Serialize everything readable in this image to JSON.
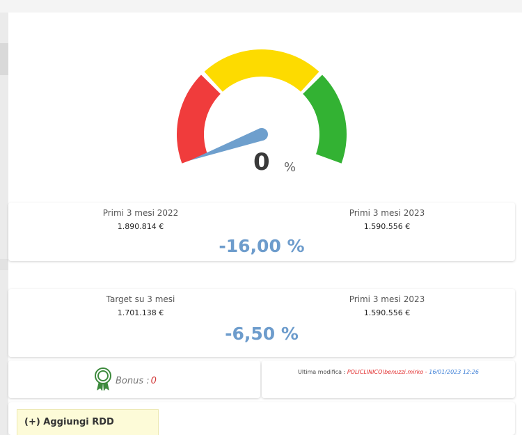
{
  "gauge": {
    "value": "0",
    "unit": "%",
    "level": 0,
    "colors": {
      "red": "#f03c3c",
      "yellow": "#fddb00",
      "green": "#33b233",
      "needle": "#6e9fcd"
    }
  },
  "comparison_previous": {
    "left_label": "Primi 3 mesi 2022",
    "left_amount": "1.890.814 €",
    "right_label": "Primi 3 mesi 2023",
    "right_amount": "1.590.556 €",
    "percentage": "-16,00 %"
  },
  "comparison_target": {
    "left_label": "Target su 3 mesi",
    "left_amount": "1.701.138 €",
    "right_label": "Primi 3 mesi 2023",
    "right_amount": "1.590.556 €",
    "percentage": "-6,50 %"
  },
  "bonus": {
    "icon": "award-ribbon-icon",
    "label": "Bonus :",
    "value": "0"
  },
  "last_modified": {
    "label": "Ultima modifica :",
    "user": "POLICLINICO\\benuzzi.mirko",
    "separator": "-",
    "date": "16/01/2023 12:26"
  },
  "actions": {
    "add_rdd_label": "(+) Aggiungi RDD"
  }
}
